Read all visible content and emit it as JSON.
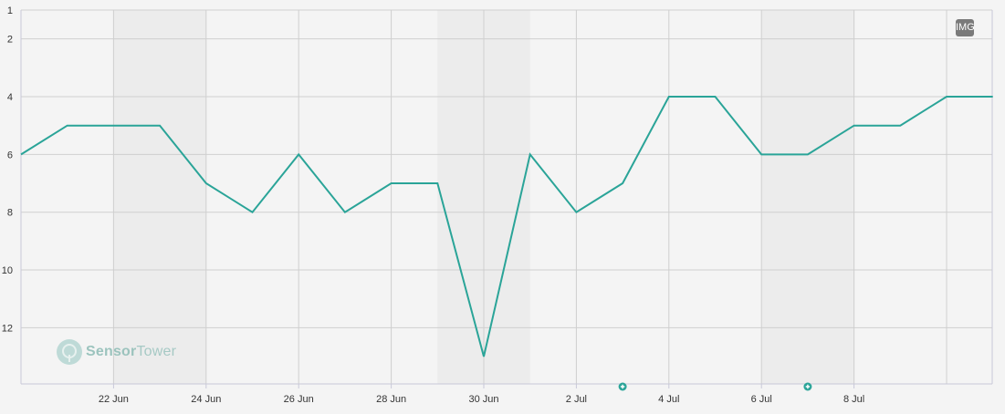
{
  "chart_data": {
    "type": "line",
    "x_ticks": [
      "22 Jun",
      "24 Jun",
      "26 Jun",
      "28 Jun",
      "30 Jun",
      "2 Jul",
      "4 Jul",
      "6 Jul",
      "8 Jul"
    ],
    "y_ticks": [
      "1",
      "2",
      "4",
      "6",
      "8",
      "10",
      "12"
    ],
    "ylim": [
      1,
      13
    ],
    "y_reversed": true,
    "grid": true,
    "series": [
      {
        "color": "#2aa498",
        "points": [
          {
            "x": "2024-06-20",
            "y": 6
          },
          {
            "x": "2024-06-21",
            "y": 5
          },
          {
            "x": "2024-06-22",
            "y": 5
          },
          {
            "x": "2024-06-23",
            "y": 5
          },
          {
            "x": "2024-06-24",
            "y": 7
          },
          {
            "x": "2024-06-25",
            "y": 8
          },
          {
            "x": "2024-06-26",
            "y": 6
          },
          {
            "x": "2024-06-27",
            "y": 8
          },
          {
            "x": "2024-06-28",
            "y": 7
          },
          {
            "x": "2024-06-29",
            "y": 7
          },
          {
            "x": "2024-06-30",
            "y": 13
          },
          {
            "x": "2024-07-01",
            "y": 6
          },
          {
            "x": "2024-07-02",
            "y": 8
          },
          {
            "x": "2024-07-03",
            "y": 7
          },
          {
            "x": "2024-07-04",
            "y": 4
          },
          {
            "x": "2024-07-05",
            "y": 4
          },
          {
            "x": "2024-07-06",
            "y": 6
          },
          {
            "x": "2024-07-07",
            "y": 6
          },
          {
            "x": "2024-07-08",
            "y": 5
          },
          {
            "x": "2024-07-09",
            "y": 5
          },
          {
            "x": "2024-07-10",
            "y": 4
          },
          {
            "x": "2024-07-11",
            "y": 4
          }
        ]
      }
    ],
    "shaded_ranges": [
      {
        "from": "2024-06-22",
        "to": "2024-06-24"
      },
      {
        "from": "2024-06-29",
        "to": "2024-07-01"
      },
      {
        "from": "2024-07-06",
        "to": "2024-07-08"
      }
    ],
    "event_markers": [
      "2024-07-03",
      "2024-07-07"
    ]
  },
  "badge": {
    "label": "IMG"
  },
  "watermark": {
    "brand_bold": "Sensor",
    "brand_light": "Tower"
  },
  "colors": {
    "line": "#2aa498",
    "marker": "#2aa498",
    "shade": "#ececec",
    "grid": "#cfcfcf",
    "axis_text": "#333333"
  }
}
